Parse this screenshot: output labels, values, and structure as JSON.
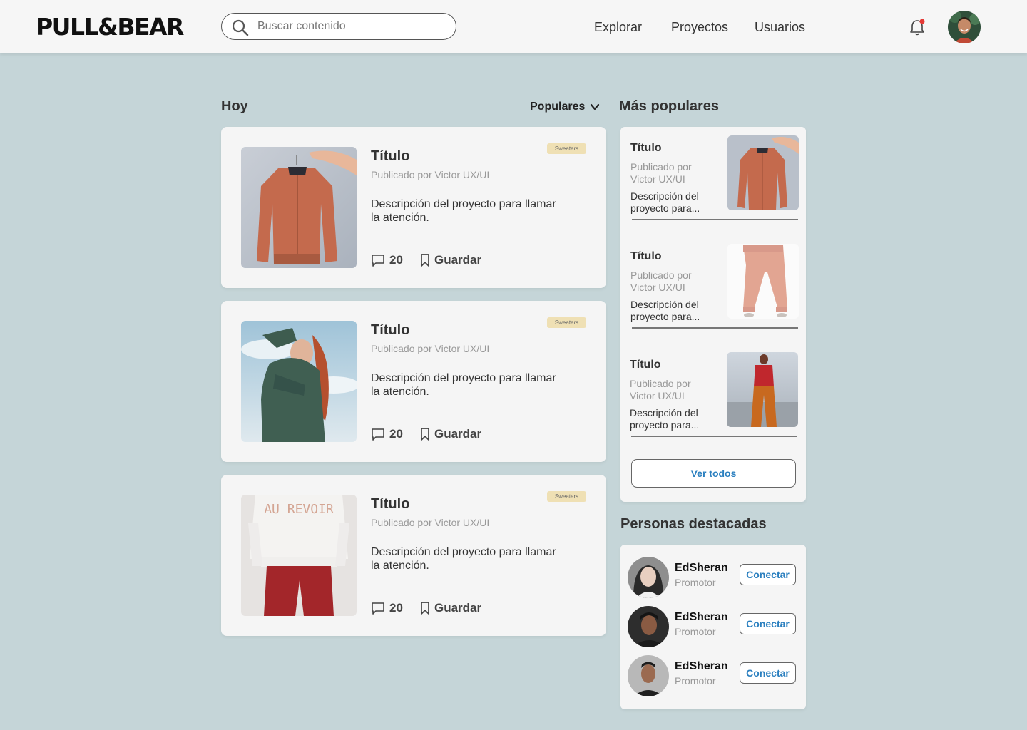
{
  "header": {
    "logo": "PULL&BEAR",
    "search_placeholder": "Buscar contenido",
    "nav": [
      "Explorar",
      "Proyectos",
      "Usuarios"
    ]
  },
  "feed": {
    "heading": "Hoy",
    "sort_label": "Populares",
    "cards": [
      {
        "title": "Título",
        "author": "Publicado por Victor UX/UI",
        "description": "Descripción del proyecto para llamar la atención.",
        "tag": "Sweaters",
        "comments": "20",
        "save_label": "Guardar",
        "image": "orange-jacket"
      },
      {
        "title": "Título",
        "author": "Publicado por Victor UX/UI",
        "description": "Descripción del proyecto para llamar la atención.",
        "tag": "Sweaters",
        "comments": "20",
        "save_label": "Guardar",
        "image": "green-sweater"
      },
      {
        "title": "Título",
        "author": "Publicado por Victor UX/UI",
        "description": "Descripción del proyecto para llamar la atención.",
        "tag": "Sweaters",
        "comments": "20",
        "save_label": "Guardar",
        "image": "au-revoir-sweatshirt"
      }
    ]
  },
  "popular": {
    "heading": "Más populares",
    "items": [
      {
        "title": "Título",
        "author": "Publicado por Victor UX/UI",
        "description": "Descripción del proyecto para...",
        "image": "orange-jacket"
      },
      {
        "title": "Título",
        "author": "Publicado por Victor UX/UI",
        "description": "Descripción del proyecto para...",
        "image": "pink-joggers"
      },
      {
        "title": "Título",
        "author": "Publicado por Victor UX/UI",
        "description": "Descripción del proyecto para...",
        "image": "red-top-orange-pants"
      }
    ],
    "see_all_label": "Ver todos"
  },
  "people": {
    "heading": "Personas destacadas",
    "items": [
      {
        "name": "EdSheran",
        "role": "Promotor",
        "button": "Conectar"
      },
      {
        "name": "EdSheran",
        "role": "Promotor",
        "button": "Conectar"
      },
      {
        "name": "EdSheran",
        "role": "Promotor",
        "button": "Conectar"
      }
    ]
  },
  "colors": {
    "background": "#c5d5d8",
    "card": "#f5f5f5",
    "accent_link": "#2a7fbf",
    "tag": "#efe0b4",
    "notification_dot": "#e53935"
  },
  "icons": [
    "search-icon",
    "chevron-down-icon",
    "bell-icon",
    "comment-icon",
    "bookmark-icon"
  ]
}
